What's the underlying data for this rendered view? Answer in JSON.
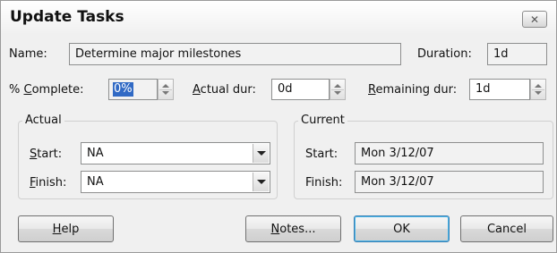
{
  "window": {
    "title": "Update Tasks",
    "close_glyph": "✕"
  },
  "name": {
    "label_pre": "Name:",
    "value": "Determine major milestones"
  },
  "duration": {
    "label": "Duration:",
    "value": "1d"
  },
  "percent_complete": {
    "label_pre": "% ",
    "label_ul": "C",
    "label_post": "omplete:",
    "value": "0%"
  },
  "actual_dur": {
    "label_ul": "A",
    "label_post": "ctual dur:",
    "value": "0d"
  },
  "remaining_dur": {
    "label_ul": "R",
    "label_post": "emaining dur:",
    "value": "1d"
  },
  "actual_group": {
    "title": "Actual",
    "start": {
      "label_ul": "S",
      "label_post": "tart:",
      "value": "NA"
    },
    "finish": {
      "label_ul": "F",
      "label_post": "inish:",
      "value": "NA"
    }
  },
  "current_group": {
    "title": "Current",
    "start": {
      "label": "Start:",
      "value": "Mon 3/12/07"
    },
    "finish": {
      "label": "Finish:",
      "value": "Mon 3/12/07"
    }
  },
  "buttons": {
    "help": {
      "ul": "H",
      "post": "elp"
    },
    "notes": {
      "ul": "N",
      "post": "otes..."
    },
    "ok": "OK",
    "cancel": "Cancel"
  },
  "icons": {
    "close": "close-icon",
    "spinner_up": "chevron-up-icon",
    "spinner_down": "chevron-down-icon",
    "dropdown": "chevron-down-icon"
  }
}
